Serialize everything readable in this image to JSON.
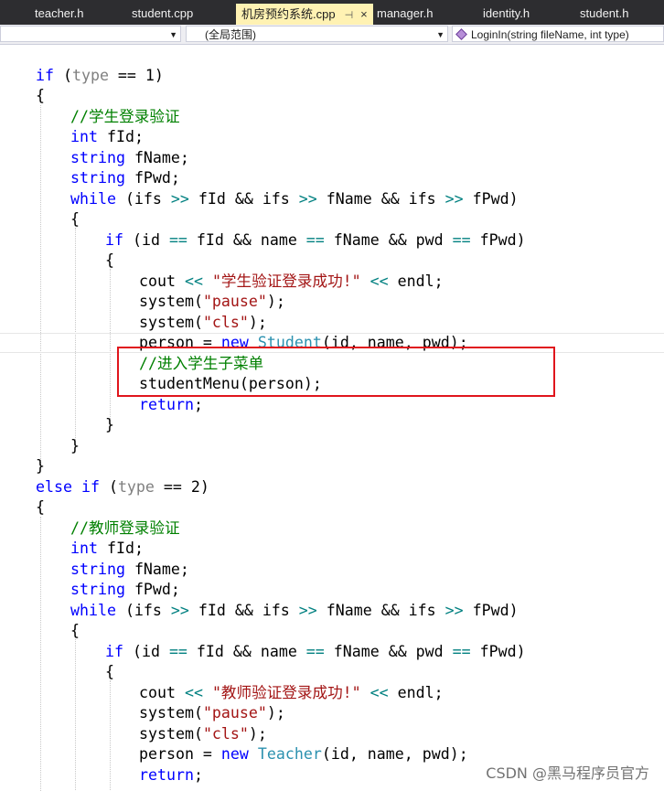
{
  "tabs": [
    {
      "label": "teacher.h"
    },
    {
      "label": "student.cpp"
    },
    {
      "label": "机房预约系统.cpp",
      "pin": "⊣",
      "close": "×"
    },
    {
      "label": "manager.h"
    },
    {
      "label": "identity.h"
    },
    {
      "label": "student.h"
    }
  ],
  "nav": {
    "project_value": "",
    "scope_value": "(全局范围)",
    "function_value": "LoginIn(string fileName, int type)"
  },
  "code": {
    "l1": [
      "if",
      " (",
      "type",
      " == 1)"
    ],
    "l2": "{",
    "l3": "//学生登录验证",
    "l4": [
      "int",
      " fId;"
    ],
    "l5": [
      "string",
      " fName;"
    ],
    "l6": [
      "string",
      " fPwd;"
    ],
    "l7": [
      "while",
      " (ifs ",
      ">>",
      " fId && ifs ",
      ">>",
      " fName && ifs ",
      ">>",
      " fPwd)"
    ],
    "l8": "{",
    "l9": [
      "if",
      " (id ",
      "==",
      " fId && name ",
      "==",
      " fName && pwd ",
      "==",
      " fPwd)"
    ],
    "l10": "{",
    "l11": [
      "cout ",
      "<<",
      " ",
      "\"学生验证登录成功!\"",
      " ",
      "<<",
      " endl;"
    ],
    "l12": [
      "system(",
      "\"pause\"",
      ");"
    ],
    "l13": [
      "system(",
      "\"cls\"",
      ");"
    ],
    "l14": [
      "person = ",
      "new",
      " ",
      "Student",
      "(id, name, pwd);"
    ],
    "l15": "//进入学生子菜单",
    "l16": "studentMenu(person);",
    "l17": [
      "return",
      ";"
    ],
    "l18": "}",
    "l19": "}",
    "l20": "}",
    "l21": [
      "else",
      " ",
      "if",
      " (",
      "type",
      " == 2)"
    ],
    "l22": "{",
    "l23": "//教师登录验证",
    "l24": [
      "int",
      " fId;"
    ],
    "l25": [
      "string",
      " fName;"
    ],
    "l26": [
      "string",
      " fPwd;"
    ],
    "l27": [
      "while",
      " (ifs ",
      ">>",
      " fId && ifs ",
      ">>",
      " fName && ifs ",
      ">>",
      " fPwd)"
    ],
    "l28": "{",
    "l29": [
      "if",
      " (id ",
      "==",
      " fId && name ",
      "==",
      " fName && pwd ",
      "==",
      " fPwd)"
    ],
    "l30": "{",
    "l31": [
      "cout ",
      "<<",
      " ",
      "\"教师验证登录成功!\"",
      " ",
      "<<",
      " endl;"
    ],
    "l32": [
      "system(",
      "\"pause\"",
      ");"
    ],
    "l33": [
      "system(",
      "\"cls\"",
      ");"
    ],
    "l34": [
      "person = ",
      "new",
      " ",
      "Teacher",
      "(id, name, pwd);"
    ],
    "l35": [
      "return",
      ";"
    ]
  },
  "watermark": "CSDN @黑马程序员官方",
  "colors": {
    "keyword": "#0000ff",
    "comment": "#008000",
    "string": "#a31515",
    "type": "#2b91af",
    "highlight_box": "#e0151c"
  }
}
